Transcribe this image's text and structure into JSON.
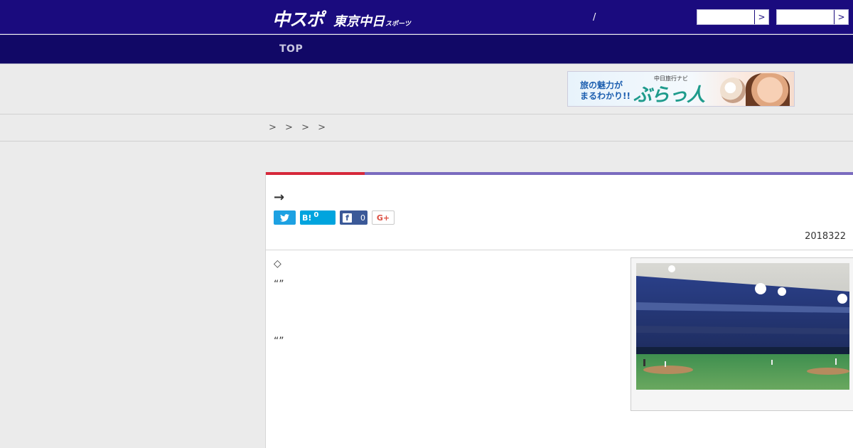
{
  "header": {
    "logo_main": "中スポ",
    "logo_sub": "東京中日",
    "logo_small": "スポーツ",
    "separator": "/",
    "button1_arrow": ">",
    "button2_arrow": ">"
  },
  "nav": {
    "top_label": "TOP"
  },
  "ad": {
    "line1": "旅の魅力が",
    "line2": "まるわかり!!",
    "small": "中日旅行ナビ",
    "brand": "ぶらっ人"
  },
  "breadcrumb": {
    "separators": [
      ">",
      ">",
      ">",
      ">"
    ]
  },
  "article": {
    "title": "→",
    "share": {
      "hatena_label": "B!",
      "hatena_count": "0",
      "facebook_count": "0",
      "gplus_label": "G+"
    },
    "date": "2018322",
    "body": [
      "◇",
      "“”",
      "“”"
    ]
  },
  "colors": {
    "header_bg": "#1a0b7e",
    "nav_bg": "#110866",
    "accent_red": "#d6283a",
    "accent_purple": "#7a6bbf"
  }
}
